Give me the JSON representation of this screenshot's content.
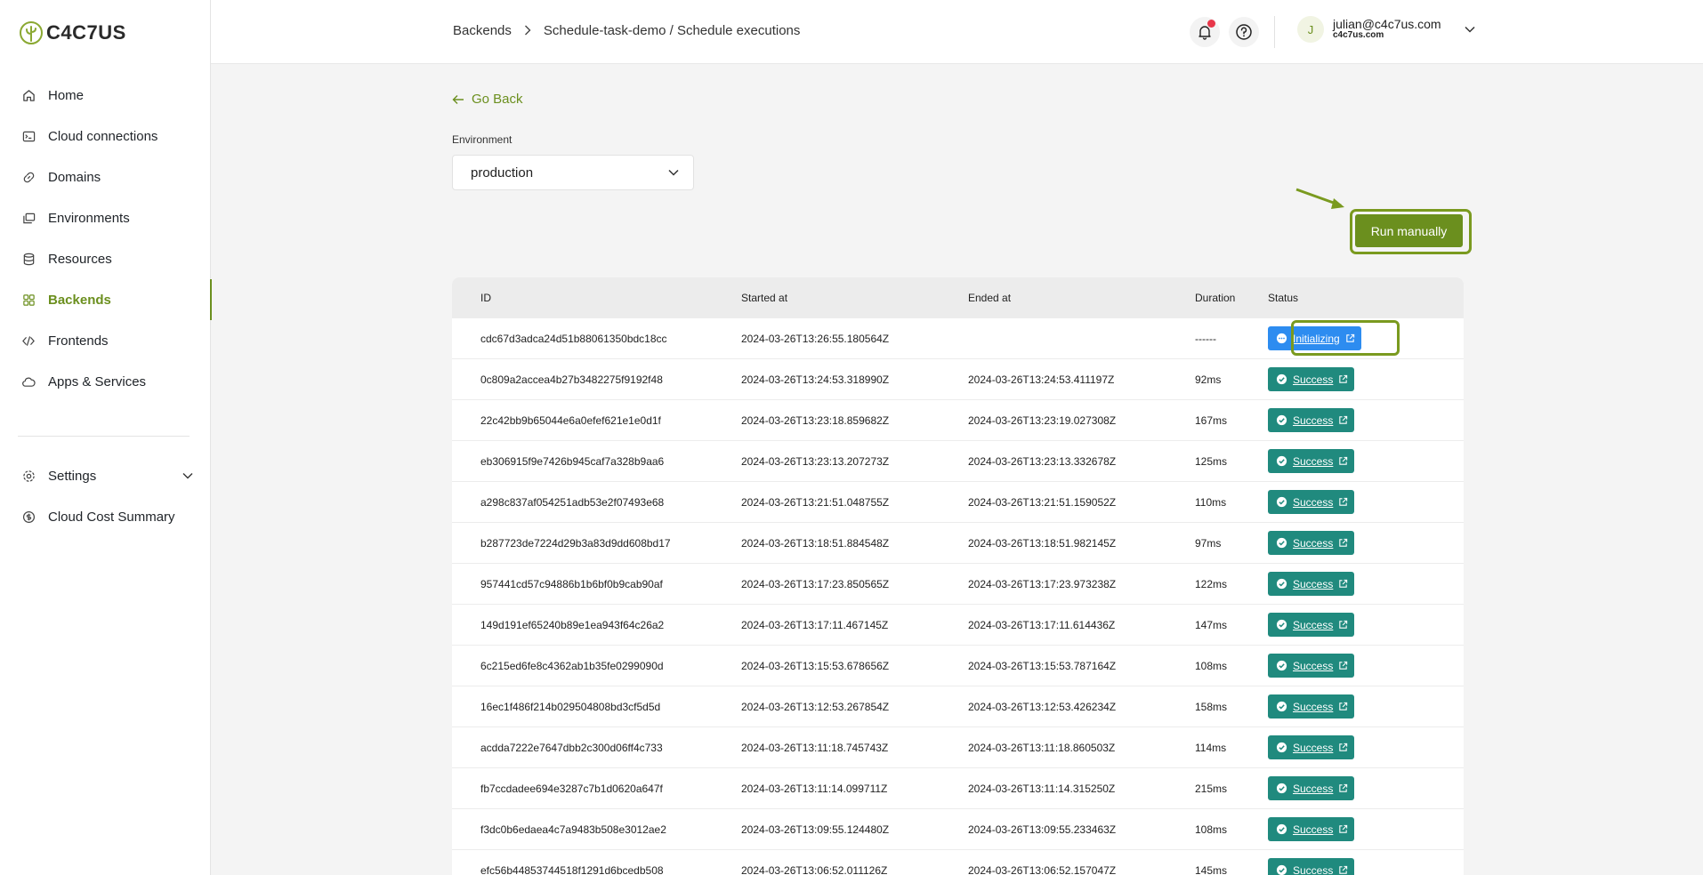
{
  "brand": {
    "name": "C4C7US"
  },
  "sidebar": {
    "items": [
      {
        "label": "Home",
        "icon": "home-icon"
      },
      {
        "label": "Cloud connections",
        "icon": "terminal-icon"
      },
      {
        "label": "Domains",
        "icon": "link-icon"
      },
      {
        "label": "Environments",
        "icon": "layers-icon"
      },
      {
        "label": "Resources",
        "icon": "database-icon"
      },
      {
        "label": "Backends",
        "icon": "grid-icon",
        "active": true
      },
      {
        "label": "Frontends",
        "icon": "code-icon"
      },
      {
        "label": "Apps & Services",
        "icon": "cloud-icon"
      }
    ],
    "bottom": [
      {
        "label": "Settings",
        "icon": "gear-icon"
      },
      {
        "label": "Cloud Cost Summary",
        "icon": "dollar-icon"
      }
    ]
  },
  "breadcrumb": {
    "first": "Backends",
    "second": "Schedule-task-demo / Schedule executions"
  },
  "user": {
    "initial": "J",
    "email": "julian@c4c7us.com",
    "org": "c4c7us.com"
  },
  "main": {
    "go_back": "Go Back",
    "env_label": "Environment",
    "env_value": "production",
    "run_button": "Run manually"
  },
  "table": {
    "headers": {
      "id": "ID",
      "started": "Started at",
      "ended": "Ended at",
      "duration": "Duration",
      "status": "Status"
    },
    "rows": [
      {
        "id": "cdc67d3adca24d51b88061350bdc18cc",
        "started": "2024-03-26T13:26:55.180564Z",
        "ended": "",
        "duration": "------",
        "status": "Initializing"
      },
      {
        "id": "0c809a2accea4b27b3482275f9192f48",
        "started": "2024-03-26T13:24:53.318990Z",
        "ended": "2024-03-26T13:24:53.411197Z",
        "duration": "92ms",
        "status": "Success"
      },
      {
        "id": "22c42bb9b65044e6a0efef621e1e0d1f",
        "started": "2024-03-26T13:23:18.859682Z",
        "ended": "2024-03-26T13:23:19.027308Z",
        "duration": "167ms",
        "status": "Success"
      },
      {
        "id": "eb306915f9e7426b945caf7a328b9aa6",
        "started": "2024-03-26T13:23:13.207273Z",
        "ended": "2024-03-26T13:23:13.332678Z",
        "duration": "125ms",
        "status": "Success"
      },
      {
        "id": "a298c837af054251adb53e2f07493e68",
        "started": "2024-03-26T13:21:51.048755Z",
        "ended": "2024-03-26T13:21:51.159052Z",
        "duration": "110ms",
        "status": "Success"
      },
      {
        "id": "b287723de7224d29b3a83d9dd608bd17",
        "started": "2024-03-26T13:18:51.884548Z",
        "ended": "2024-03-26T13:18:51.982145Z",
        "duration": "97ms",
        "status": "Success"
      },
      {
        "id": "957441cd57c94886b1b6bf0b9cab90af",
        "started": "2024-03-26T13:17:23.850565Z",
        "ended": "2024-03-26T13:17:23.973238Z",
        "duration": "122ms",
        "status": "Success"
      },
      {
        "id": "149d191ef65240b89e1ea943f64c26a2",
        "started": "2024-03-26T13:17:11.467145Z",
        "ended": "2024-03-26T13:17:11.614436Z",
        "duration": "147ms",
        "status": "Success"
      },
      {
        "id": "6c215ed6fe8c4362ab1b35fe0299090d",
        "started": "2024-03-26T13:15:53.678656Z",
        "ended": "2024-03-26T13:15:53.787164Z",
        "duration": "108ms",
        "status": "Success"
      },
      {
        "id": "16ec1f486f214b029504808bd3cf5d5d",
        "started": "2024-03-26T13:12:53.267854Z",
        "ended": "2024-03-26T13:12:53.426234Z",
        "duration": "158ms",
        "status": "Success"
      },
      {
        "id": "acdda7222e7647dbb2c300d06ff4c733",
        "started": "2024-03-26T13:11:18.745743Z",
        "ended": "2024-03-26T13:11:18.860503Z",
        "duration": "114ms",
        "status": "Success"
      },
      {
        "id": "fb7ccdadee694e3287c7b1d0620a647f",
        "started": "2024-03-26T13:11:14.099711Z",
        "ended": "2024-03-26T13:11:14.315250Z",
        "duration": "215ms",
        "status": "Success"
      },
      {
        "id": "f3dc0b6edaea4c7a9483b508e3012ae2",
        "started": "2024-03-26T13:09:55.124480Z",
        "ended": "2024-03-26T13:09:55.233463Z",
        "duration": "108ms",
        "status": "Success"
      },
      {
        "id": "efc56b44853744518f1291d6bcedb508",
        "started": "2024-03-26T13:06:52.011126Z",
        "ended": "2024-03-26T13:06:52.157047Z",
        "duration": "145ms",
        "status": "Success"
      }
    ]
  },
  "colors": {
    "accent": "#6b8f1e",
    "success": "#208a7e",
    "initializing": "#2d8cf0",
    "notification": "#e8374a"
  }
}
